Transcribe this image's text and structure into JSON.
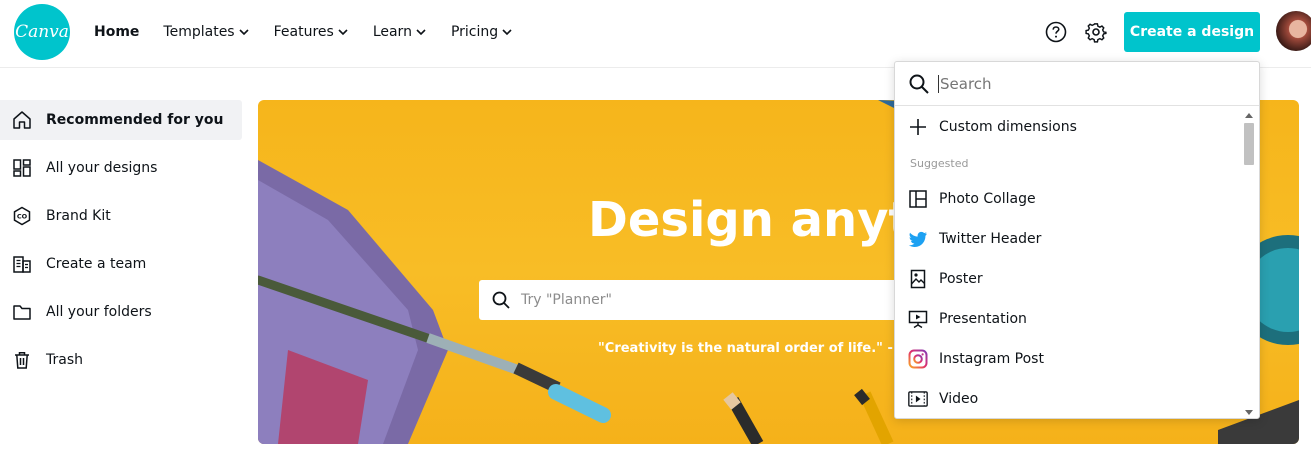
{
  "brand": {
    "logo_text": "Canva",
    "accent": "#00c4cc"
  },
  "nav": {
    "items": [
      {
        "label": "Home",
        "dropdown": false
      },
      {
        "label": "Templates",
        "dropdown": true
      },
      {
        "label": "Features",
        "dropdown": true
      },
      {
        "label": "Learn",
        "dropdown": true
      },
      {
        "label": "Pricing",
        "dropdown": true
      }
    ],
    "help_icon": "question-circle-icon",
    "settings_icon": "gear-icon",
    "create_label": "Create a design"
  },
  "sidebar": {
    "items": [
      {
        "label": "Recommended for you",
        "icon": "home-icon",
        "active": true
      },
      {
        "label": "All your designs",
        "icon": "grid-icon",
        "active": false
      },
      {
        "label": "Brand Kit",
        "icon": "brand-kit-icon",
        "active": false
      },
      {
        "label": "Create a team",
        "icon": "building-icon",
        "active": false
      },
      {
        "label": "All your folders",
        "icon": "folder-icon",
        "active": false
      },
      {
        "label": "Trash",
        "icon": "trash-icon",
        "active": false
      }
    ]
  },
  "hero": {
    "title": "Design anythi",
    "search_placeholder": "Try \"Planner\"",
    "quote": "\"Creativity is the natural order of life.\" - Julia C"
  },
  "dropdown": {
    "search_placeholder": "Search",
    "custom_label": "Custom dimensions",
    "section_label": "Suggested",
    "items": [
      {
        "label": "Photo Collage",
        "icon": "collage-icon"
      },
      {
        "label": "Twitter Header",
        "icon": "twitter-icon"
      },
      {
        "label": "Poster",
        "icon": "poster-icon"
      },
      {
        "label": "Presentation",
        "icon": "presentation-icon"
      },
      {
        "label": "Instagram Post",
        "icon": "instagram-icon"
      },
      {
        "label": "Video",
        "icon": "video-icon"
      }
    ]
  }
}
